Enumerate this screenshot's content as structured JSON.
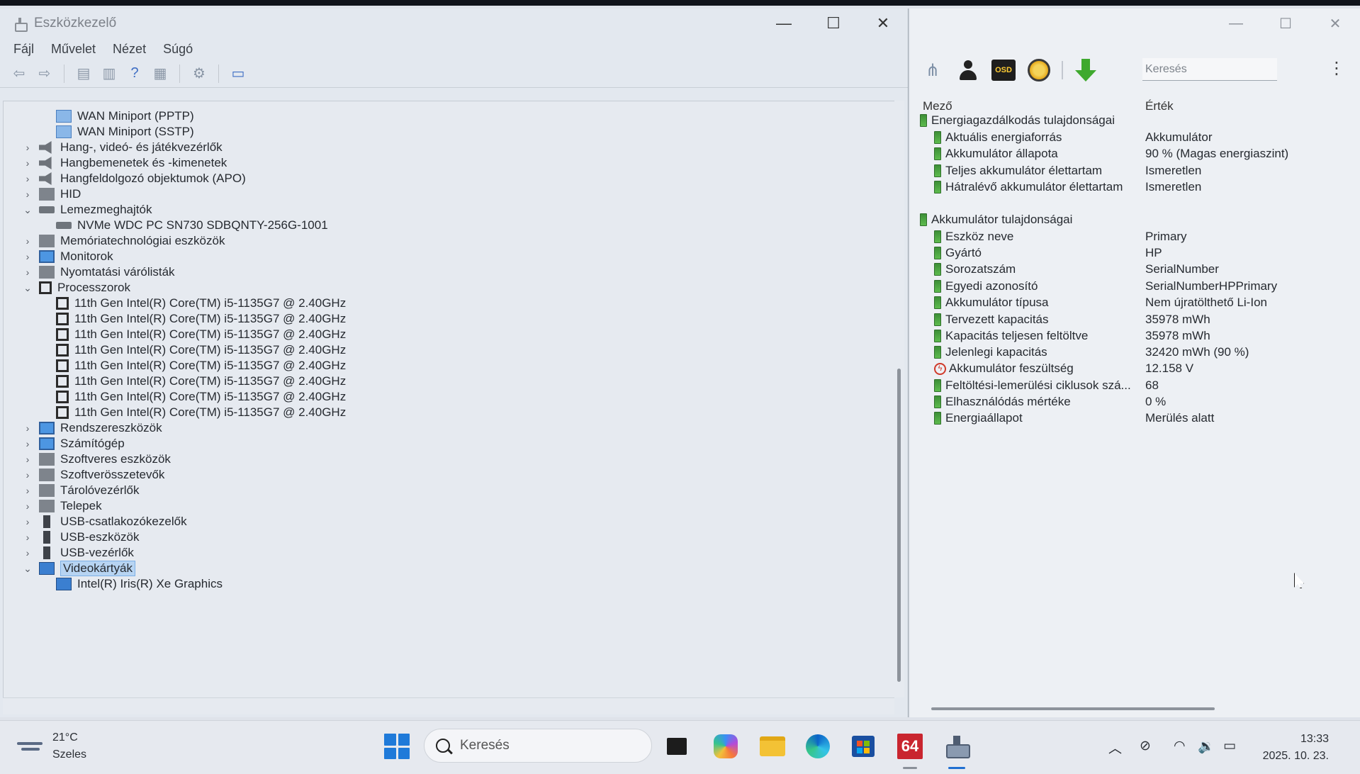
{
  "device_manager": {
    "title": "Eszközkezelő",
    "window_controls": {
      "minimize": "—",
      "maximize": "☐",
      "close": "✕"
    },
    "menu": [
      "Fájl",
      "Művelet",
      "Nézet",
      "Súgó"
    ],
    "toolbar_icons": [
      "back-icon",
      "forward-icon",
      "properties-grid-icon",
      "document-icon",
      "help-icon",
      "details-grid-icon",
      "driver-icon",
      "monitor-icon"
    ],
    "tree": [
      {
        "label": "WAN Miniport (PPTP)",
        "level": 1,
        "icon": "net"
      },
      {
        "label": "WAN Miniport (SSTP)",
        "level": 1,
        "icon": "net"
      },
      {
        "label": "Hang-, videó- és játékvezérlők",
        "level": 0,
        "icon": "spk",
        "chevron": "›"
      },
      {
        "label": "Hangbemenetek és -kimenetek",
        "level": 0,
        "icon": "spk",
        "chevron": "›"
      },
      {
        "label": "Hangfeldolgozó objektumok (APO)",
        "level": 0,
        "icon": "spk",
        "chevron": "›"
      },
      {
        "label": "HID",
        "level": 0,
        "icon": "gen",
        "chevron": "›"
      },
      {
        "label": "Lemezmeghajtók",
        "level": 0,
        "icon": "disk",
        "chevron": "⌄"
      },
      {
        "label": "NVMe WDC PC SN730 SDBQNTY-256G-1001",
        "level": 1,
        "icon": "disk"
      },
      {
        "label": "Memóriatechnológiai eszközök",
        "level": 0,
        "icon": "gen",
        "chevron": "›"
      },
      {
        "label": "Monitorok",
        "level": 0,
        "icon": "mon",
        "chevron": "›"
      },
      {
        "label": "Nyomtatási várólisták",
        "level": 0,
        "icon": "gen",
        "chevron": "›"
      },
      {
        "label": "Processzorok",
        "level": 0,
        "icon": "cpu",
        "chevron": "⌄"
      },
      {
        "label": "11th Gen Intel(R) Core(TM) i5-1135G7 @ 2.40GHz",
        "level": 1,
        "icon": "cpu"
      },
      {
        "label": "11th Gen Intel(R) Core(TM) i5-1135G7 @ 2.40GHz",
        "level": 1,
        "icon": "cpu"
      },
      {
        "label": "11th Gen Intel(R) Core(TM) i5-1135G7 @ 2.40GHz",
        "level": 1,
        "icon": "cpu"
      },
      {
        "label": "11th Gen Intel(R) Core(TM) i5-1135G7 @ 2.40GHz",
        "level": 1,
        "icon": "cpu"
      },
      {
        "label": "11th Gen Intel(R) Core(TM) i5-1135G7 @ 2.40GHz",
        "level": 1,
        "icon": "cpu"
      },
      {
        "label": "11th Gen Intel(R) Core(TM) i5-1135G7 @ 2.40GHz",
        "level": 1,
        "icon": "cpu"
      },
      {
        "label": "11th Gen Intel(R) Core(TM) i5-1135G7 @ 2.40GHz",
        "level": 1,
        "icon": "cpu"
      },
      {
        "label": "11th Gen Intel(R) Core(TM) i5-1135G7 @ 2.40GHz",
        "level": 1,
        "icon": "cpu"
      },
      {
        "label": "Rendszereszközök",
        "level": 0,
        "icon": "mon",
        "chevron": "›"
      },
      {
        "label": "Számítógép",
        "level": 0,
        "icon": "mon",
        "chevron": "›"
      },
      {
        "label": "Szoftveres eszközök",
        "level": 0,
        "icon": "gen",
        "chevron": "›"
      },
      {
        "label": "Szoftverösszetevők",
        "level": 0,
        "icon": "gen",
        "chevron": "›"
      },
      {
        "label": "Tárolóvezérlők",
        "level": 0,
        "icon": "gen",
        "chevron": "›"
      },
      {
        "label": "Telepek",
        "level": 0,
        "icon": "gen",
        "chevron": "›"
      },
      {
        "label": "USB-csatlakozókezelők",
        "level": 0,
        "icon": "usb",
        "chevron": "›"
      },
      {
        "label": "USB-eszközök",
        "level": 0,
        "icon": "usb",
        "chevron": "›"
      },
      {
        "label": "USB-vezérlők",
        "level": 0,
        "icon": "usb",
        "chevron": "›"
      },
      {
        "label": "Videokártyák",
        "level": 0,
        "icon": "gpu",
        "chevron": "⌄",
        "selected": true
      },
      {
        "label": "Intel(R) Iris(R) Xe Graphics",
        "level": 1,
        "icon": "gpu"
      }
    ]
  },
  "info_panel": {
    "window_controls": {
      "minimize": "—",
      "maximize": "☐",
      "close": "✕"
    },
    "toolbar": {
      "osd_label": "OSD",
      "search_placeholder": "Keresés",
      "more": "⋮"
    },
    "columns": {
      "field": "Mező",
      "value": "Érték"
    },
    "sections": [
      {
        "title": "Energiagazdálkodás tulajdonságai",
        "rows": [
          {
            "field": "Aktuális energiaforrás",
            "value": "Akkumulátor"
          },
          {
            "field": "Akkumulátor állapota",
            "value": "90 % (Magas energiaszint)"
          },
          {
            "field": "Teljes akkumulátor élettartam",
            "value": "Ismeretlen"
          },
          {
            "field": "Hátralévő akkumulátor élettartam",
            "value": "Ismeretlen"
          }
        ]
      },
      {
        "title": "Akkumulátor tulajdonságai",
        "rows": [
          {
            "field": "Eszköz neve",
            "value": "Primary"
          },
          {
            "field": "Gyártó",
            "value": "HP"
          },
          {
            "field": "Sorozatszám",
            "value": "SerialNumber"
          },
          {
            "field": "Egyedi azonosító",
            "value": "SerialNumberHPPrimary"
          },
          {
            "field": "Akkumulátor típusa",
            "value": "Nem újratölthető Li-Ion"
          },
          {
            "field": "Tervezett kapacitás",
            "value": "35978 mWh"
          },
          {
            "field": "Kapacitás teljesen feltöltve",
            "value": "35978 mWh"
          },
          {
            "field": "Jelenlegi kapacitás",
            "value": "32420 mWh  (90 %)"
          },
          {
            "field": "Akkumulátor feszültség",
            "value": "12.158 V",
            "icon": "voltage"
          },
          {
            "field": "Feltöltési-lemerülési ciklusok szá...",
            "value": "68"
          },
          {
            "field": "Elhasználódás mértéke",
            "value": "0 %"
          },
          {
            "field": "Energiaállapot",
            "value": "Merülés alatt"
          }
        ]
      }
    ]
  },
  "taskbar": {
    "weather": {
      "temp": "21°C",
      "condition": "Szeles"
    },
    "search_placeholder": "Keresés",
    "app_64_label": "64",
    "clock": {
      "time": "13:33",
      "date": "2025. 10. 23."
    }
  }
}
